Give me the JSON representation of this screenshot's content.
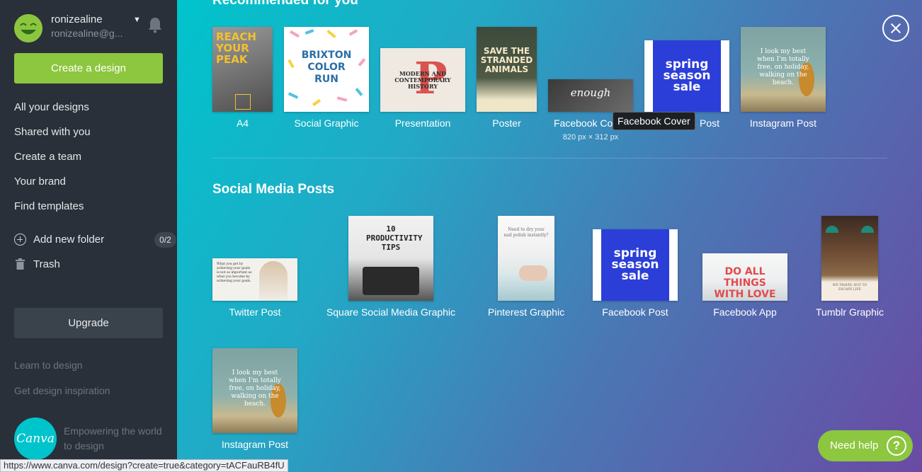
{
  "user": {
    "name": "ronizealine",
    "email": "ronizealine@g..."
  },
  "sidebar": {
    "create_label": "Create a design",
    "nav": [
      "All your designs",
      "Shared with you",
      "Create a team",
      "Your brand",
      "Find templates"
    ],
    "add_folder_label": "Add new folder",
    "folder_count": "0/2",
    "trash_label": "Trash",
    "upgrade_label": "Upgrade",
    "learn_label": "Learn to design",
    "inspiration_label": "Get design inspiration",
    "logo_text": "Canva",
    "tagline": "Empowering the world to design"
  },
  "recommended": {
    "title": "Recommended for you",
    "items": [
      {
        "label": "A4",
        "thumb_text": "REACH YOUR PEAK"
      },
      {
        "label": "Social Graphic",
        "thumb_text": "BRIXTON COLOR RUN"
      },
      {
        "label": "Presentation",
        "thumb_text": "MODERN AND CONTEMPORARY HISTORY"
      },
      {
        "label": "Poster",
        "thumb_text": "SAVE THE STRANDED ANIMALS"
      },
      {
        "label": "Facebook Co",
        "sub": "820 px × 312 px",
        "thumb_text": "enough"
      },
      {
        "label": "Post",
        "thumb_text": "spring season sale"
      },
      {
        "label": "Instagram Post",
        "thumb_text": "I look my best when I'm totally free, on holiday, walking on the beach."
      }
    ]
  },
  "tooltip": "Facebook Cover",
  "social": {
    "title": "Social Media Posts",
    "items": [
      {
        "label": "Twitter Post",
        "thumb_text": "What you get by achieving your goals is not as important as what you become by achieving your goals."
      },
      {
        "label": "Square Social Media Graphic",
        "thumb_text": "10 PRODUCTIVITY TIPS"
      },
      {
        "label": "Pinterest Graphic",
        "thumb_text": "Need to dry your nail polish instantly?"
      },
      {
        "label": "Facebook Post",
        "thumb_text": "spring season sale"
      },
      {
        "label": "Facebook App",
        "thumb_text": "DO ALL THINGS WITH LOVE"
      },
      {
        "label": "Tumblr Graphic",
        "thumb_text": "WE TRAVEL NOT TO ESCAPE LIFE"
      },
      {
        "label": "Instagram Post",
        "thumb_text": "I look my best when I'm totally free, on holiday, walking on the beach."
      }
    ]
  },
  "help_label": "Need help",
  "help_icon": "?",
  "status_url": "https://www.canva.com/design?create=true&category=tACFauRB4fU",
  "colors": {
    "accent": "#8dc63f",
    "sidebar": "#293039",
    "teal": "#00c4cc",
    "purple": "#6a4aa4"
  }
}
